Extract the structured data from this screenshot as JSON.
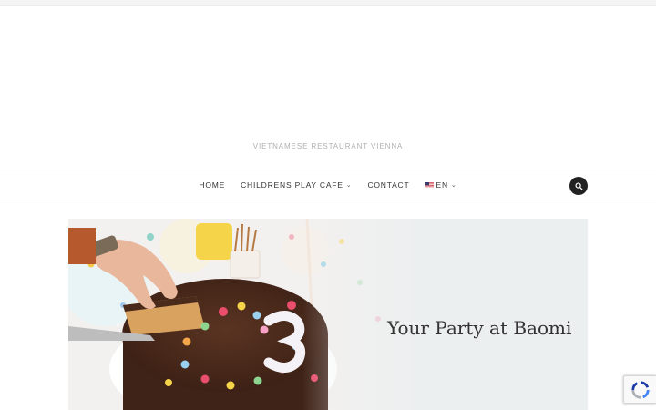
{
  "site": {
    "tagline": "VIETNAMESE RESTAURANT VIENNA"
  },
  "nav": {
    "items": [
      {
        "label": "HOME",
        "has_dropdown": false
      },
      {
        "label": "CHILDRENS PLAY CAFE",
        "has_dropdown": true
      },
      {
        "label": "CONTACT",
        "has_dropdown": false
      }
    ],
    "language": {
      "label": "EN",
      "flag": "us-flag-icon",
      "has_dropdown": true
    },
    "search_icon": "search-icon"
  },
  "hero": {
    "title": "Your Party at Baomi",
    "image": "birthday-cake-photo"
  },
  "widgets": {
    "recaptcha_icon": "recaptcha-icon"
  },
  "colors": {
    "nav_text": "#333333",
    "tagline": "#b0b0b0",
    "search_button": "#222222",
    "hero_background": "#eceff0"
  }
}
